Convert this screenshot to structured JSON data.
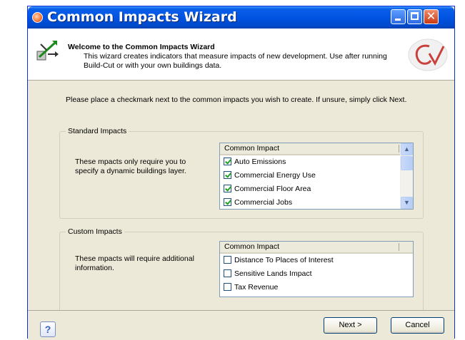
{
  "window": {
    "title": "Common Impacts Wizard",
    "icon": "wizard-app-icon",
    "controls": {
      "minimize": "minimize-icon",
      "maximize": "maximize-icon",
      "close": "close-icon"
    }
  },
  "header": {
    "title": "Welcome to the Common Impacts Wizard",
    "description": "This wizard creates indicators that measure impacts of new development.  Use after running Build-Cut or with your own buildings data."
  },
  "intro": "Please place a checkmark next to the common impacts you wish to create.  If unsure, simply click Next.",
  "standard": {
    "label": "Standard Impacts",
    "description": "These mpacts only require you to specify a dynamic buildings layer.",
    "column": "Common Impact",
    "items": [
      {
        "label": "Auto Emissions",
        "checked": true
      },
      {
        "label": "Commercial Energy Use",
        "checked": true
      },
      {
        "label": "Commercial Floor Area",
        "checked": true
      },
      {
        "label": "Commercial Jobs",
        "checked": true
      }
    ]
  },
  "custom": {
    "label": "Custom Impacts",
    "description": "These mpacts will require additional information.",
    "column": "Common Impact",
    "items": [
      {
        "label": "Distance To Places of Interest",
        "checked": false
      },
      {
        "label": "Sensitive Lands Impact",
        "checked": false
      },
      {
        "label": "Tax Revenue",
        "checked": false
      }
    ]
  },
  "footer": {
    "help": "?",
    "next": "Next >",
    "cancel": "Cancel"
  },
  "colors": {
    "titlebar": "#0054e3",
    "dialog": "#ece9d8",
    "check": "#21a121"
  }
}
